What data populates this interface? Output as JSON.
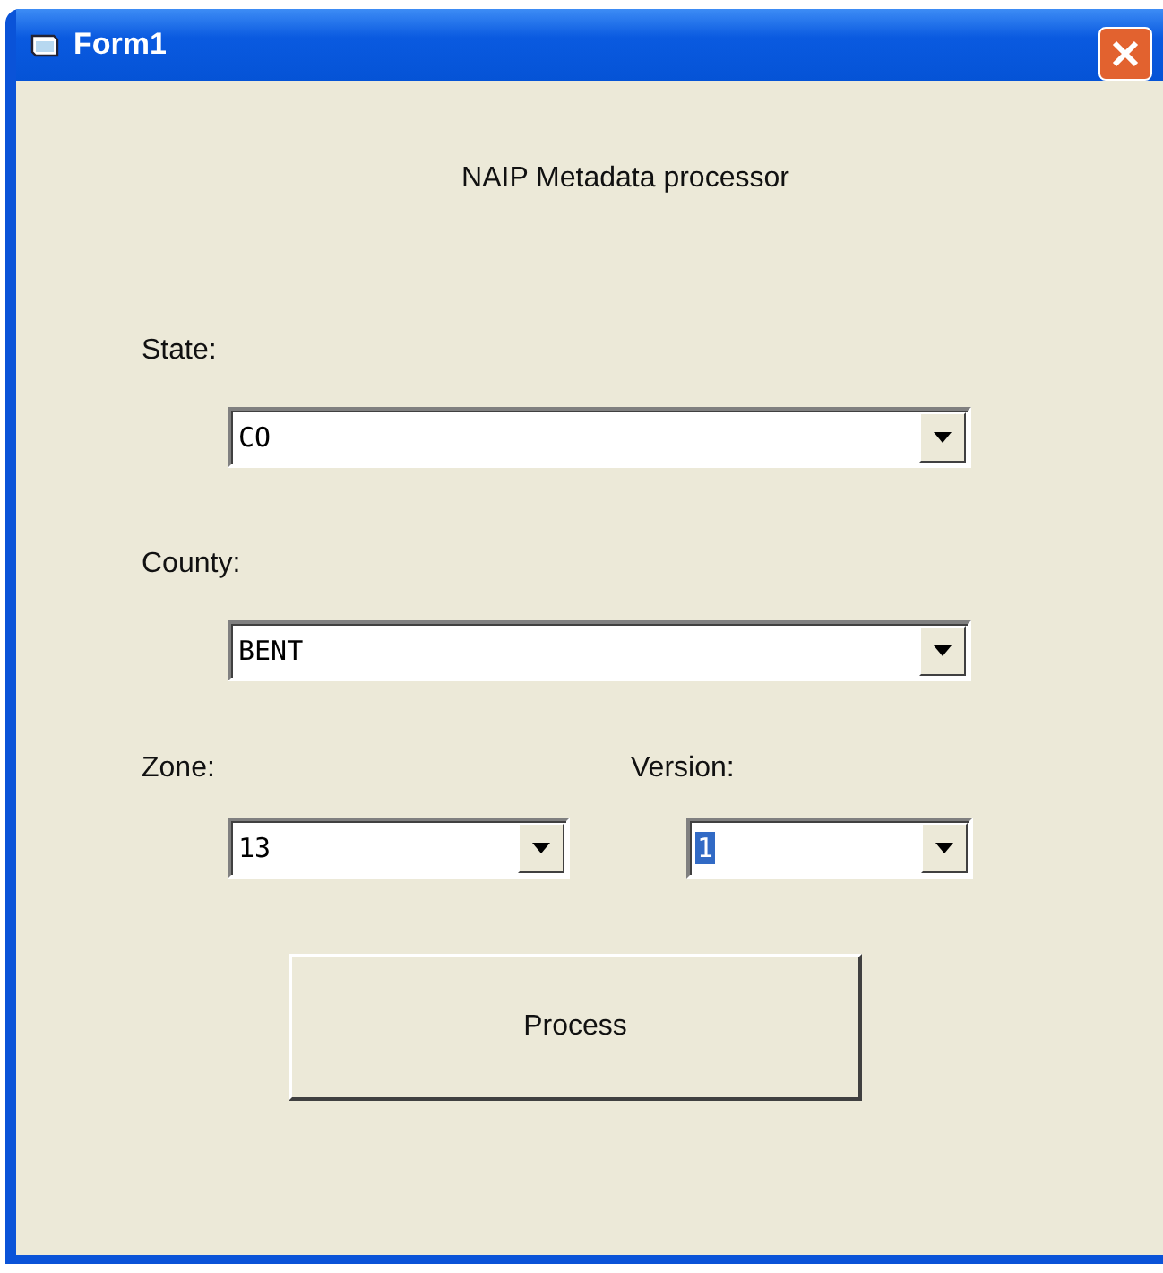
{
  "window": {
    "title": "Form1"
  },
  "heading": "NAIP Metadata processor",
  "state": {
    "label": "State:",
    "value": "CO"
  },
  "county": {
    "label": "County:",
    "value": "BENT"
  },
  "zone": {
    "label": "Zone:",
    "value": "13"
  },
  "version": {
    "label": "Version:",
    "value": "1",
    "text_selected": true
  },
  "button": "Process"
}
